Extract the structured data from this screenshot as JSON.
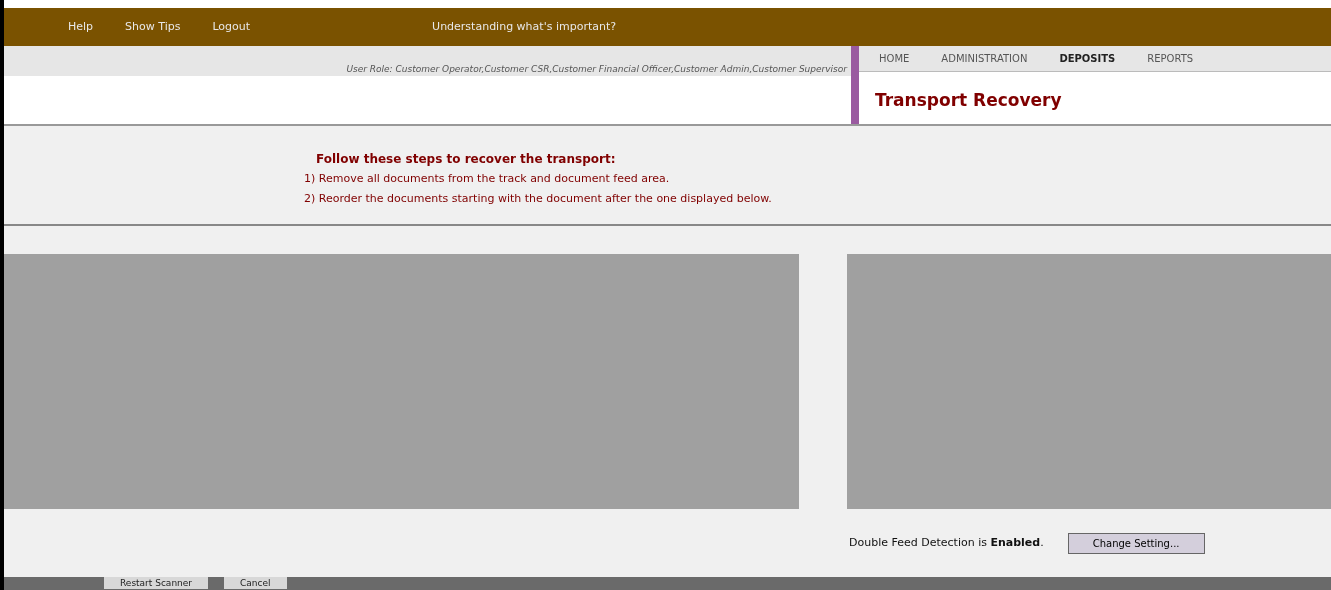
{
  "header": {
    "links": [
      "Help",
      "Show Tips",
      "Logout"
    ],
    "tip_link": "Understanding what's important?"
  },
  "user_role": "User Role: Customer Operator,Customer CSR,Customer Financial Officer,Customer Admin,Customer Supervisor",
  "nav": [
    {
      "label": "HOME",
      "selected": false
    },
    {
      "label": "ADMINISTRATION",
      "selected": false
    },
    {
      "label": "DEPOSITS",
      "selected": true
    },
    {
      "label": "REPORTS",
      "selected": false
    }
  ],
  "page_title": "Transport Recovery",
  "instructions": {
    "heading": "Follow these steps to recover the transport:",
    "steps": [
      "1) Remove all documents from the track and document feed area.",
      "2) Reorder the documents starting with the document after the one displayed below."
    ]
  },
  "double_feed": "Double Feed Detection is **Enabled**.",
  "change_button": "Change Setting...",
  "footer_buttons": [
    "Restart Scanner",
    "Cancel"
  ]
}
